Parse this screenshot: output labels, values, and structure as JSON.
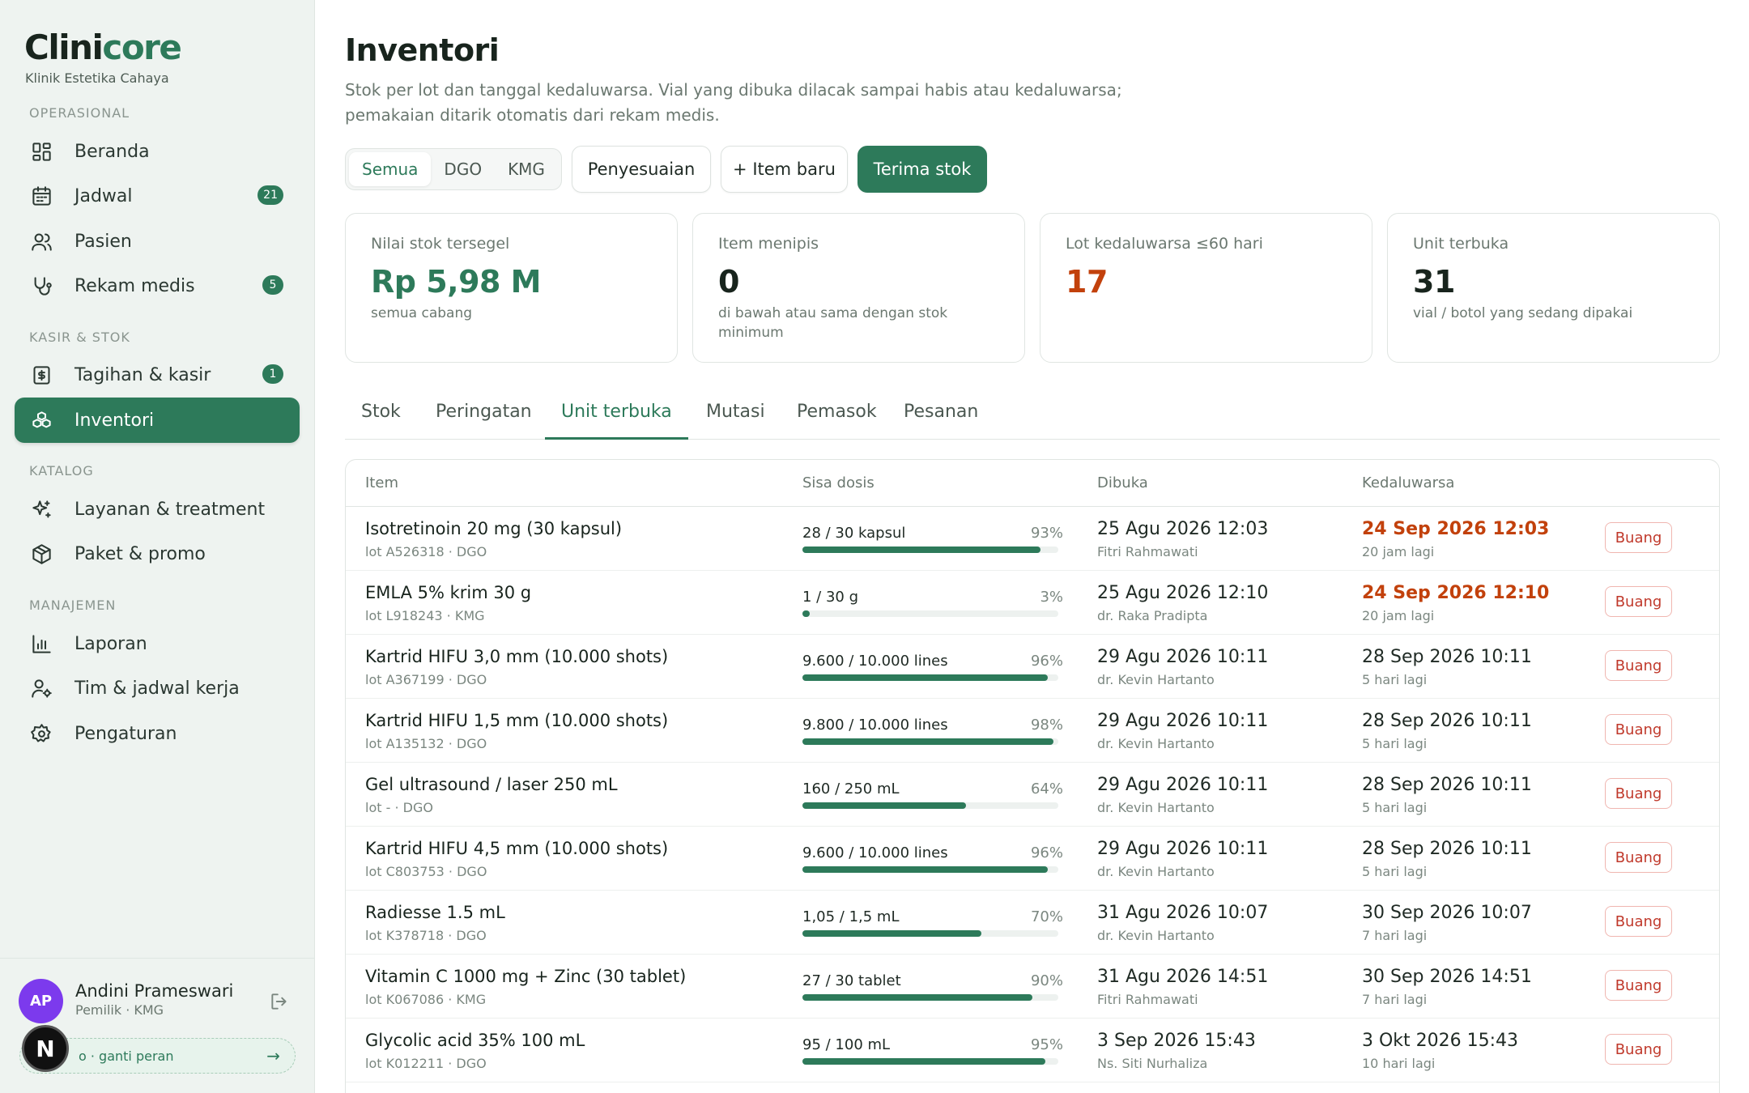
{
  "brand": {
    "name_part1": "Clini",
    "name_part2": "core",
    "subtitle": "Klinik Estetika Cahaya"
  },
  "sidebar": {
    "sections": [
      "OPERASIONAL",
      "KASIR & STOK",
      "KATALOG",
      "MANAJEMEN"
    ],
    "items": [
      {
        "label": "Beranda",
        "icon": "grid-icon"
      },
      {
        "label": "Jadwal",
        "icon": "calendar-icon",
        "badge": "21"
      },
      {
        "label": "Pasien",
        "icon": "users-icon"
      },
      {
        "label": "Rekam medis",
        "icon": "stethoscope-icon",
        "badge": "5"
      },
      {
        "label": "Tagihan & kasir",
        "icon": "receipt-icon",
        "badge": "1"
      },
      {
        "label": "Inventori",
        "icon": "boxes-icon",
        "active": true
      },
      {
        "label": "Layanan & treatment",
        "icon": "sparkle-icon"
      },
      {
        "label": "Paket & promo",
        "icon": "package-icon"
      },
      {
        "label": "Laporan",
        "icon": "bar-chart-icon"
      },
      {
        "label": "Tim & jadwal kerja",
        "icon": "user-cog-icon"
      },
      {
        "label": "Pengaturan",
        "icon": "gear-icon"
      }
    ]
  },
  "user": {
    "initials": "AP",
    "name": "Andini Prameswari",
    "role": "Pemilik · KMG",
    "switch_label": "o · ganti peran",
    "switch_arrow": "→",
    "overlay_badge": "N"
  },
  "page": {
    "title": "Inventori",
    "description": "Stok per lot dan tanggal kedaluwarsa. Vial yang dibuka dilacak sampai habis atau kedaluwarsa; pemakaian ditarik otomatis dari rekam medis."
  },
  "filters": {
    "options": [
      "Semua",
      "DGO",
      "KMG"
    ],
    "selected": "Semua"
  },
  "actions": {
    "adjust": "Penyesuaian",
    "new_item": "+ Item baru",
    "receive": "Terima stok"
  },
  "stats": [
    {
      "label": "Nilai stok tersegel",
      "value": "Rp 5,98 M",
      "note": "semua cabang",
      "color": "#2d7a5a"
    },
    {
      "label": "Item menipis",
      "value": "0",
      "note": "di bawah atau sama dengan stok minimum",
      "color": "#18241d"
    },
    {
      "label": "Lot kedaluwarsa ≤60 hari",
      "value": "17",
      "note": "",
      "color": "#c2410c"
    },
    {
      "label": "Unit terbuka",
      "value": "31",
      "note": "vial / botol yang sedang dipakai",
      "color": "#18241d"
    }
  ],
  "tabs": [
    "Stok",
    "Peringatan",
    "Unit terbuka",
    "Mutasi",
    "Pemasok",
    "Pesanan"
  ],
  "active_tab": "Unit terbuka",
  "table": {
    "headers": [
      "Item",
      "Sisa dosis",
      "Dibuka",
      "Kedaluwarsa"
    ],
    "discard_label": "Buang",
    "rows": [
      {
        "name": "Isotretinoin 20 mg (30 kapsul)",
        "lot": "lot A526318 · DGO",
        "dose": "28 / 30 kapsul",
        "pct": "93%",
        "fill": 0.93,
        "opened": "25 Agu 2026 12:03",
        "opener": "Fitri Rahmawati",
        "expiry": "24 Sep 2026 12:03",
        "relative": "20 jam lagi",
        "warn": true
      },
      {
        "name": "EMLA 5% krim 30 g",
        "lot": "lot L918243 · KMG",
        "dose": "1 / 30 g",
        "pct": "3%",
        "fill": 0.03,
        "opened": "25 Agu 2026 12:10",
        "opener": "dr. Raka Pradipta",
        "expiry": "24 Sep 2026 12:10",
        "relative": "20 jam lagi",
        "warn": true
      },
      {
        "name": "Kartrid HIFU 3,0 mm (10.000 shots)",
        "lot": "lot A367199 · DGO",
        "dose": "9.600 / 10.000 lines",
        "pct": "96%",
        "fill": 0.96,
        "opened": "29 Agu 2026 10:11",
        "opener": "dr. Kevin Hartanto",
        "expiry": "28 Sep 2026 10:11",
        "relative": "5 hari lagi",
        "warn": false
      },
      {
        "name": "Kartrid HIFU 1,5 mm (10.000 shots)",
        "lot": "lot A135132 · DGO",
        "dose": "9.800 / 10.000 lines",
        "pct": "98%",
        "fill": 0.98,
        "opened": "29 Agu 2026 10:11",
        "opener": "dr. Kevin Hartanto",
        "expiry": "28 Sep 2026 10:11",
        "relative": "5 hari lagi",
        "warn": false
      },
      {
        "name": "Gel ultrasound / laser 250 mL",
        "lot": "lot - · DGO",
        "dose": "160 / 250 mL",
        "pct": "64%",
        "fill": 0.64,
        "opened": "29 Agu 2026 10:11",
        "opener": "dr. Kevin Hartanto",
        "expiry": "28 Sep 2026 10:11",
        "relative": "5 hari lagi",
        "warn": false
      },
      {
        "name": "Kartrid HIFU 4,5 mm (10.000 shots)",
        "lot": "lot C803753 · DGO",
        "dose": "9.600 / 10.000 lines",
        "pct": "96%",
        "fill": 0.96,
        "opened": "29 Agu 2026 10:11",
        "opener": "dr. Kevin Hartanto",
        "expiry": "28 Sep 2026 10:11",
        "relative": "5 hari lagi",
        "warn": false
      },
      {
        "name": "Radiesse 1.5 mL",
        "lot": "lot K378718 · DGO",
        "dose": "1,05 / 1,5 mL",
        "pct": "70%",
        "fill": 0.7,
        "opened": "31 Agu 2026 10:07",
        "opener": "dr. Kevin Hartanto",
        "expiry": "30 Sep 2026 10:07",
        "relative": "7 hari lagi",
        "warn": false
      },
      {
        "name": "Vitamin C 1000 mg + Zinc (30 tablet)",
        "lot": "lot K067086 · KMG",
        "dose": "27 / 30 tablet",
        "pct": "90%",
        "fill": 0.9,
        "opened": "31 Agu 2026 14:51",
        "opener": "Fitri Rahmawati",
        "expiry": "30 Sep 2026 14:51",
        "relative": "7 hari lagi",
        "warn": false
      },
      {
        "name": "Glycolic acid 35% 100 mL",
        "lot": "lot K012211 · DGO",
        "dose": "95 / 100 mL",
        "pct": "95%",
        "fill": 0.95,
        "opened": "3 Sep 2026 15:43",
        "opener": "Ns. Siti Nurhaliza",
        "expiry": "3 Okt 2026 15:43",
        "relative": "10 hari lagi",
        "warn": false
      }
    ]
  }
}
